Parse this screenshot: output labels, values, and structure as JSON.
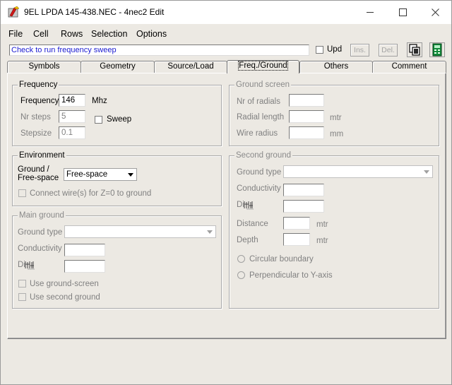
{
  "window": {
    "title": "9EL LPDA 145-438.NEC - 4nec2 Edit"
  },
  "menu": [
    "File",
    "Cell",
    "Rows",
    "Selection",
    "Options"
  ],
  "toolbar": {
    "status_text": "Check to run frequency sweep",
    "upd_label": "Upd",
    "ins_label": "Ins.",
    "del_label": "Del."
  },
  "tabs": [
    "Symbols",
    "Geometry",
    "Source/Load",
    "Freq./Ground",
    "Others",
    "Comment"
  ],
  "active_tab": "Freq./Ground",
  "frequency": {
    "title": "Frequency",
    "frequency_label": "Frequency",
    "frequency_value": "146",
    "frequency_unit": "Mhz",
    "nr_steps_label": "Nr steps",
    "nr_steps_value": "5",
    "sweep_label": "Sweep",
    "stepsize_label": "Stepsize",
    "stepsize_value": "0.1"
  },
  "environment": {
    "title": "Environment",
    "ground_label_1": "Ground  /",
    "ground_label_2": "Free-space",
    "ground_value": "Free-space",
    "connect_label": "Connect wire(s) for Z=0 to ground"
  },
  "main_ground": {
    "title": "Main ground",
    "ground_type_label": "Ground type",
    "conductivity_label": "Conductivity",
    "diel_label": "Di",
    "use_ground_screen_label": "Use ground-screen",
    "use_second_ground_label": "Use second ground"
  },
  "ground_screen": {
    "title": "Ground screen",
    "nr_radials_label": "Nr of radials",
    "radial_length_label": "Radial length",
    "radial_length_unit": "mtr",
    "wire_radius_label": "Wire radius",
    "wire_radius_unit": "mm"
  },
  "second_ground": {
    "title": "Second ground",
    "ground_type_label": "Ground type",
    "conductivity_label": "Conductivity",
    "diel_label": "Di",
    "distance_label": "Distance",
    "distance_unit": "mtr",
    "depth_label": "Depth",
    "depth_unit": "mtr",
    "circular_label": "Circular boundary",
    "perpendicular_label": "Perpendicular to Y-axis"
  },
  "colors": {
    "window_bg": "#ece9e3",
    "status_text": "#1b1bd0",
    "disabled_text": "#808080"
  }
}
